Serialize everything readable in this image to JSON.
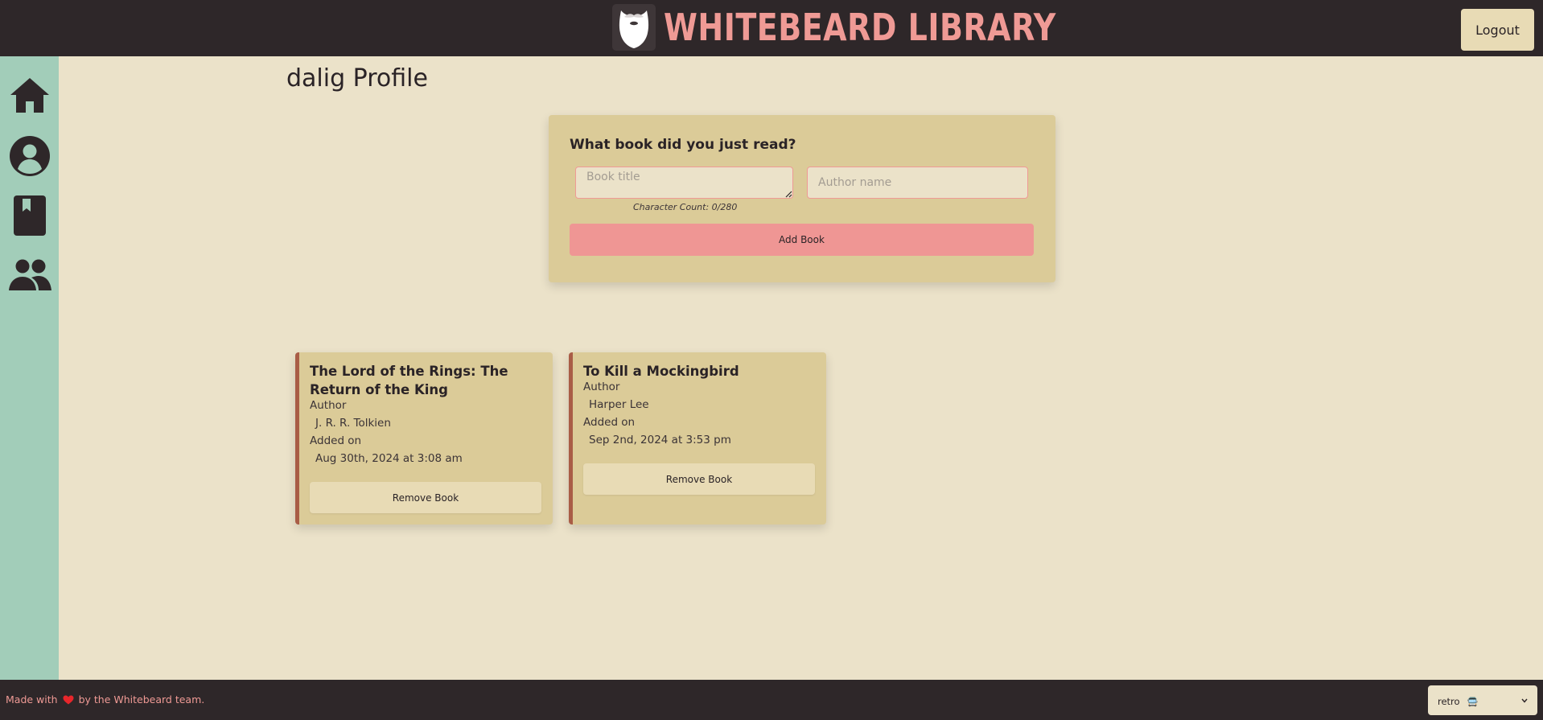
{
  "header": {
    "brand_title": "WHITEBEARD LIBRARY",
    "logout_label": "Logout"
  },
  "sidebar": {
    "items": [
      {
        "icon": "home-icon"
      },
      {
        "icon": "profile-icon"
      },
      {
        "icon": "book-icon"
      },
      {
        "icon": "friends-icon"
      }
    ]
  },
  "profile": {
    "title": "dalig Profile"
  },
  "form": {
    "heading": "What book did you just read?",
    "title_placeholder": "Book title",
    "author_placeholder": "Author name",
    "char_count": "Character Count: 0/280",
    "add_label": "Add Book"
  },
  "books": [
    {
      "title": "The Lord of the Rings: The Return of the King",
      "author_label": "Author",
      "author": "J. R. R. Tolkien",
      "added_label": "Added on",
      "added": "Aug 30th, 2024 at 3:08 am",
      "remove_label": "Remove Book"
    },
    {
      "title": "To Kill a Mockingbird",
      "author_label": "Author",
      "author": "Harper Lee",
      "added_label": "Added on",
      "added": "Sep 2nd, 2024 at 3:53 pm",
      "remove_label": "Remove Book"
    }
  ],
  "footer": {
    "text_before": "Made with",
    "text_after": "by the Whitebeard team.",
    "theme_value": "retro",
    "theme_emoji": "🚍"
  },
  "colors": {
    "topbar": "#2e2729",
    "accent_pink": "#ef9a95",
    "sidebar": "#a2cdb9",
    "background": "#ebe2c9",
    "card": "#dbcb98",
    "card_border": "#a95d46"
  }
}
